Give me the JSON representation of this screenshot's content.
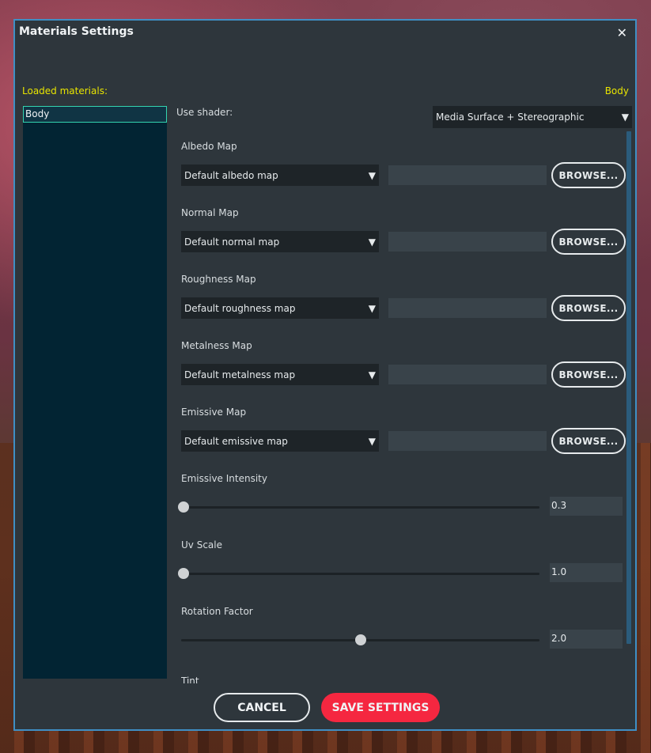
{
  "window": {
    "title": "Materials Settings",
    "close_glyph": "✕"
  },
  "loaded_materials": {
    "label": "Loaded materials:",
    "items": [
      "Body"
    ]
  },
  "selected_material": "Body",
  "shader": {
    "label": "Use shader:",
    "value": "Media Surface + Stereographic"
  },
  "maps": [
    {
      "label": "Albedo Map",
      "value": "Default albedo map",
      "browse": "BROWSE..."
    },
    {
      "label": "Normal Map",
      "value": "Default normal map",
      "browse": "BROWSE..."
    },
    {
      "label": "Roughness Map",
      "value": "Default roughness map",
      "browse": "BROWSE..."
    },
    {
      "label": "Metalness Map",
      "value": "Default metalness map",
      "browse": "BROWSE..."
    },
    {
      "label": "Emissive Map",
      "value": "Default emissive map",
      "browse": "BROWSE..."
    }
  ],
  "sliders": [
    {
      "label": "Emissive Intensity",
      "value": "0.3",
      "fraction": 0.0
    },
    {
      "label": "Uv Scale",
      "value": "1.0",
      "fraction": 0.0
    },
    {
      "label": "Rotation Factor",
      "value": "2.0",
      "fraction": 0.5
    }
  ],
  "tint_label": "Tint",
  "buttons": {
    "cancel": "CANCEL",
    "save": "SAVE SETTINGS"
  },
  "icons": {
    "dropdown_arrow": "▼"
  },
  "colors": {
    "accent_yellow": "#e8e400",
    "border_blue": "#3f8fc4",
    "save_red": "#f52740",
    "selection_teal": "#33d4b0"
  }
}
